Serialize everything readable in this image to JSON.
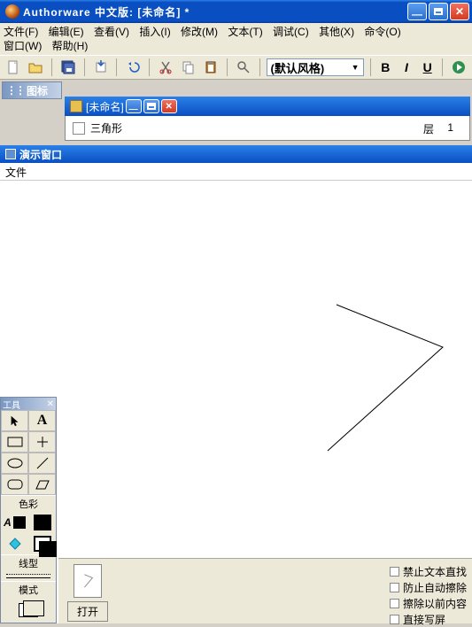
{
  "app": {
    "title": "Authorware 中文版: [未命名] *"
  },
  "menu": {
    "file": "文件(F)",
    "edit": "编辑(E)",
    "view": "查看(V)",
    "insert": "插入(I)",
    "modify": "修改(M)",
    "text": "文本(T)",
    "debug": "调试(C)",
    "other": "其他(X)",
    "command": "命令(O)",
    "window": "窗口(W)",
    "help": "帮助(H)"
  },
  "toolbar": {
    "style_default": "(默认风格)",
    "bold": "B",
    "italic": "I",
    "underline": "U"
  },
  "panels": {
    "icons_title": "图标",
    "tools_title": "工具",
    "color_label": "色彩",
    "line_label": "线型",
    "mode_label": "模式",
    "close_glyph": "✕"
  },
  "doc": {
    "title": "[未命名]",
    "item_name": "三角形",
    "layer_label": "层",
    "layer_value": "1"
  },
  "present": {
    "title": "演示窗口",
    "menu_file": "文件"
  },
  "bottom": {
    "open_btn": "打开",
    "checks": {
      "c1": "禁止文本直找",
      "c2": "防止自动擦除",
      "c3": "擦除以前内容",
      "c4": "直接写屏"
    }
  }
}
